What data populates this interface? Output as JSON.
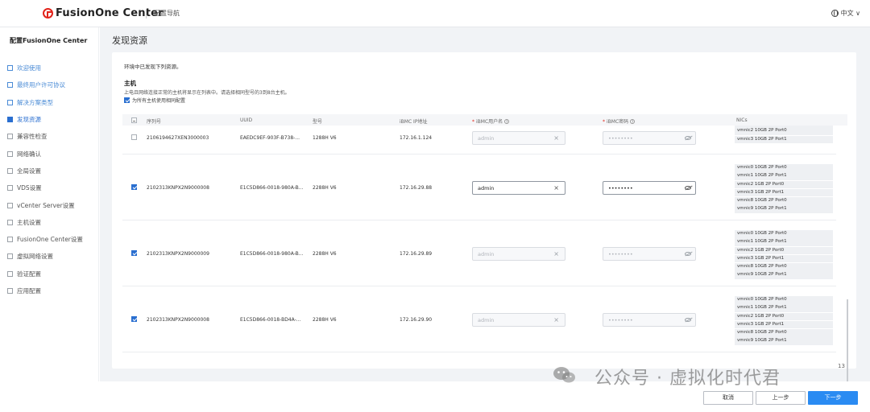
{
  "header": {
    "brand": "FusionOne Center",
    "subtitle": "配置导航",
    "language": "中文 ∨"
  },
  "sidebar": {
    "title": "配置FusionOne Center",
    "items": [
      {
        "label": "欢迎使用",
        "state": "done"
      },
      {
        "label": "最终用户许可协议",
        "state": "done"
      },
      {
        "label": "解决方案类型",
        "state": "done"
      },
      {
        "label": "发现资源",
        "state": "active"
      },
      {
        "label": "兼容性检查",
        "state": "todo"
      },
      {
        "label": "网络确认",
        "state": "todo"
      },
      {
        "label": "全局设置",
        "state": "todo"
      },
      {
        "label": "VDS设置",
        "state": "todo"
      },
      {
        "label": "vCenter Server设置",
        "state": "todo"
      },
      {
        "label": "主机设置",
        "state": "todo"
      },
      {
        "label": "FusionOne Center设置",
        "state": "todo"
      },
      {
        "label": "虚拟网络设置",
        "state": "todo"
      },
      {
        "label": "验证配置",
        "state": "todo"
      },
      {
        "label": "应用配置",
        "state": "todo"
      }
    ]
  },
  "main": {
    "title": "发现资源",
    "intro": "环境中已发现下列资源。",
    "host_title": "主机",
    "host_desc": "上电且网络连接正常的主机将显示在列表中。请选择相同型号的3到8台主机。",
    "same_config_label": "为所有主机使用相同配置",
    "columns": {
      "serial": "序列号",
      "uuid": "UUID",
      "model": "型号",
      "ibmc_ip": "iBMC IP地址",
      "ibmc_user": "iBMC用户名",
      "ibmc_pwd": "iBMC密码",
      "nics": "NICs",
      "help": "?"
    },
    "rows": [
      {
        "checked": false,
        "serial": "2106194627XEN3000003",
        "uuid": "EAEDC9EF-903F-B738-...",
        "model": "1288H V6",
        "ip": "172.16.1.124",
        "user": "admin",
        "pwd": "••••••••",
        "nics": [
          "vmnic1 1GB 2P Port1",
          "vmnic2 10GB 2P Port0",
          "vmnic3 10GB 2P Port1"
        ]
      },
      {
        "checked": true,
        "serial": "2102313KNPX2N9000008",
        "uuid": "E1C5D866-0018-980A-B...",
        "model": "2288H V6",
        "ip": "172.16.29.88",
        "user": "admin",
        "pwd": "••••••••",
        "nics": [
          "vmnic0 10GB 2P Port0",
          "vmnic1 10GB 2P Port1",
          "vmnic2 1GB 2P Port0",
          "vmnic3 1GB 2P Port1",
          "vmnic8 10GB 2P Port0",
          "vmnic9 10GB 2P Port1"
        ]
      },
      {
        "checked": true,
        "serial": "2102313KNPX2N9000009",
        "uuid": "E1C5D866-0018-980A-B...",
        "model": "2288H V6",
        "ip": "172.16.29.89",
        "user": "admin",
        "pwd": "••••••••",
        "nics": [
          "vmnic0 10GB 2P Port0",
          "vmnic1 10GB 2P Port1",
          "vmnic2 1GB 2P Port0",
          "vmnic3 1GB 2P Port1",
          "vmnic8 10GB 2P Port0",
          "vmnic9 10GB 2P Port1"
        ]
      },
      {
        "checked": true,
        "serial": "2102313KNPX2N9000008",
        "uuid": "E1C5D866-0018-BD4A-...",
        "model": "2288H V6",
        "ip": "172.16.29.90",
        "user": "admin",
        "pwd": "••••••••",
        "nics": [
          "vmnic0 10GB 2P Port0",
          "vmnic1 10GB 2P Port1",
          "vmnic2 1GB 2P Port0",
          "vmnic3 1GB 2P Port1",
          "vmnic8 10GB 2P Port0",
          "vmnic9 10GB 2P Port1"
        ]
      }
    ]
  },
  "footer": {
    "cancel": "取消",
    "prev": "上一步",
    "next": "下一步"
  },
  "watermark": "公众号 · 虚拟化时代君",
  "page_tag": "13",
  "colors": {
    "primary": "#2a8bf2",
    "brand_red": "#e2231a",
    "active_nav": "#2a6fd0"
  }
}
